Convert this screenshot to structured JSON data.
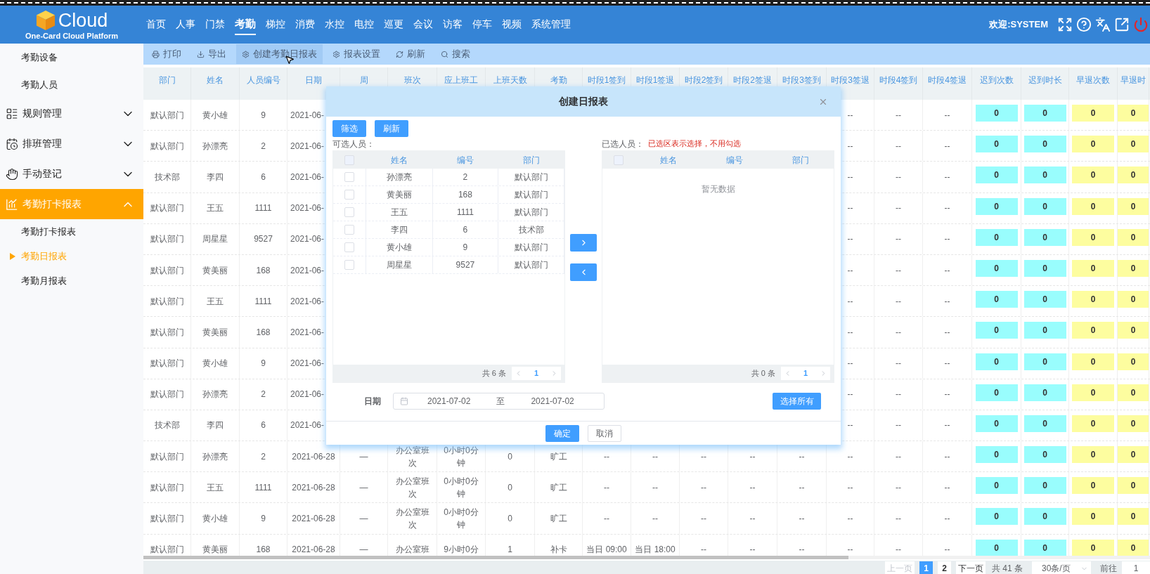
{
  "header": {
    "logo_text": "Cloud",
    "logo_subtitle": "One-Card Cloud Platform",
    "nav": [
      {
        "label": "首页",
        "selected": false
      },
      {
        "label": "人事",
        "selected": false
      },
      {
        "label": "门禁",
        "selected": false
      },
      {
        "label": "考勤",
        "selected": true
      },
      {
        "label": "梯控",
        "selected": false
      },
      {
        "label": "消费",
        "selected": false
      },
      {
        "label": "水控",
        "selected": false
      },
      {
        "label": "电控",
        "selected": false
      },
      {
        "label": "巡更",
        "selected": false
      },
      {
        "label": "会议",
        "selected": false
      },
      {
        "label": "访客",
        "selected": false
      },
      {
        "label": "停车",
        "selected": false
      },
      {
        "label": "视频",
        "selected": false
      },
      {
        "label": "系统管理",
        "selected": false
      }
    ],
    "welcome": "欢迎:SYSTEM"
  },
  "sidebar": {
    "items": [
      {
        "kind": "link",
        "label": "考勤设备",
        "selected": false
      },
      {
        "kind": "link",
        "label": "考勤人员",
        "selected": false
      },
      {
        "kind": "group",
        "label": "规则管理",
        "selected": false,
        "expanded": false
      },
      {
        "kind": "group",
        "label": "排班管理",
        "selected": false,
        "expanded": false
      },
      {
        "kind": "group",
        "label": "手动登记",
        "selected": false,
        "expanded": false
      },
      {
        "kind": "group",
        "label": "考勤打卡报表",
        "selected": true,
        "expanded": true,
        "children": [
          {
            "label": "考勤打卡报表",
            "selected": false
          },
          {
            "label": "考勤日报表",
            "selected": true
          },
          {
            "label": "考勤月报表",
            "selected": false
          }
        ]
      }
    ]
  },
  "toolbar": {
    "buttons": [
      {
        "label": "打印",
        "highlighted": false
      },
      {
        "label": "导出",
        "highlighted": false
      },
      {
        "label": "创建考勤日报表",
        "highlighted": true
      },
      {
        "label": "报表设置",
        "highlighted": false
      },
      {
        "label": "刷新",
        "highlighted": false
      },
      {
        "label": "搜索",
        "highlighted": false
      }
    ]
  },
  "table": {
    "columns": [
      {
        "label": "部门"
      },
      {
        "label": "姓名"
      },
      {
        "label": "人员编号"
      },
      {
        "label": "日期"
      },
      {
        "label": "周"
      },
      {
        "label": "班次"
      },
      {
        "label": "应上班工"
      },
      {
        "label": "上班天数"
      },
      {
        "label": "考勤"
      },
      {
        "label": "时段1签到"
      },
      {
        "label": "时段1签退"
      },
      {
        "label": "时段2签到"
      },
      {
        "label": "时段2签退"
      },
      {
        "label": "时段3签到"
      },
      {
        "label": "时段3签退"
      },
      {
        "label": "时段4签到"
      },
      {
        "label": "时段4签退"
      },
      {
        "label": "迟到次数",
        "color": "#99fdfd"
      },
      {
        "label": "迟到时长",
        "color": "#99fdfd"
      },
      {
        "label": "早退次数",
        "color": "#fdfd9f"
      },
      {
        "label": "早退时",
        "color": "#fdfd9f"
      }
    ],
    "rows": [
      {
        "cells": [
          "默认部门",
          "黄小雄",
          "9",
          "2021-06-",
          null,
          null,
          null,
          null,
          null,
          null,
          null,
          null,
          null,
          null,
          "--",
          "--",
          "--",
          "0",
          "0",
          "0",
          "0"
        ]
      },
      {
        "cells": [
          "默认部门",
          "孙漂亮",
          "2",
          "2021-06-",
          null,
          null,
          null,
          null,
          null,
          null,
          null,
          null,
          null,
          null,
          "--",
          "--",
          "--",
          "0",
          "0",
          "0",
          "0"
        ]
      },
      {
        "cells": [
          "技术部",
          "李四",
          "6",
          "2021-06-",
          null,
          null,
          null,
          null,
          null,
          null,
          null,
          null,
          null,
          null,
          "--",
          "--",
          "--",
          "0",
          "0",
          "0",
          "0"
        ]
      },
      {
        "cells": [
          "默认部门",
          "王五",
          "1111",
          "2021-06-",
          null,
          null,
          null,
          null,
          null,
          null,
          null,
          null,
          null,
          null,
          "--",
          "--",
          "--",
          "0",
          "0",
          "0",
          "0"
        ]
      },
      {
        "cells": [
          "默认部门",
          "周星星",
          "9527",
          "2021-06-",
          null,
          null,
          null,
          null,
          null,
          null,
          null,
          null,
          null,
          null,
          "--",
          "--",
          "--",
          "0",
          "0",
          "0",
          "0"
        ]
      },
      {
        "cells": [
          "默认部门",
          "黄美丽",
          "168",
          "2021-06-",
          null,
          null,
          null,
          null,
          null,
          null,
          null,
          null,
          null,
          null,
          "--",
          "--",
          "--",
          "0",
          "0",
          "0",
          "0"
        ]
      },
      {
        "cells": [
          "默认部门",
          "王五",
          "1111",
          "2021-06-",
          null,
          null,
          null,
          null,
          null,
          null,
          null,
          null,
          null,
          null,
          "--",
          "--",
          "--",
          "0",
          "0",
          "0",
          "0"
        ]
      },
      {
        "cells": [
          "默认部门",
          "黄美丽",
          "168",
          "2021-06-",
          null,
          null,
          null,
          null,
          null,
          null,
          null,
          null,
          null,
          null,
          "--",
          "--",
          "--",
          "0",
          "0",
          "0",
          "0"
        ]
      },
      {
        "cells": [
          "默认部门",
          "黄小雄",
          "9",
          "2021-06-",
          null,
          null,
          null,
          null,
          null,
          null,
          null,
          null,
          null,
          null,
          "--",
          "--",
          "--",
          "0",
          "0",
          "0",
          "0"
        ]
      },
      {
        "cells": [
          "默认部门",
          "孙漂亮",
          "2",
          "2021-06-",
          null,
          null,
          null,
          null,
          null,
          null,
          null,
          null,
          null,
          null,
          "--",
          "--",
          "--",
          "0",
          "0",
          "0",
          "0"
        ]
      },
      {
        "cells": [
          "技术部",
          "李四",
          "6",
          "2021-06-",
          null,
          null,
          null,
          null,
          null,
          null,
          null,
          null,
          null,
          null,
          "--",
          "--",
          "--",
          "0",
          "0",
          "0",
          "0"
        ]
      },
      {
        "cells": [
          "默认部门",
          "孙漂亮",
          "2",
          "2021-06-28",
          "—",
          "办公室班次",
          "0小时0分钟",
          "0",
          "旷工",
          "--",
          "--",
          "--",
          "--",
          "--",
          "--",
          "--",
          "--",
          "0",
          "0",
          "0",
          "0"
        ]
      },
      {
        "cells": [
          "默认部门",
          "王五",
          "1111",
          "2021-06-28",
          "—",
          "办公室班次",
          "0小时0分钟",
          "0",
          "旷工",
          "--",
          "--",
          "--",
          "--",
          "--",
          "--",
          "--",
          "--",
          "0",
          "0",
          "0",
          "0"
        ]
      },
      {
        "cells": [
          "默认部门",
          "黄小雄",
          "9",
          "2021-06-28",
          "—",
          "办公室班次",
          "0小时0分钟",
          "0",
          "旷工",
          "--",
          "--",
          "--",
          "--",
          "--",
          "--",
          "--",
          "--",
          "0",
          "0",
          "0",
          "0"
        ]
      },
      {
        "cells": [
          "默认部门",
          "黄美丽",
          "168",
          "2021-06-28",
          "—",
          "办公室班",
          "9小时0分",
          "1",
          "补卡",
          "当日 09:00",
          "当日 18:00",
          "--",
          "--",
          "--",
          "--",
          "--",
          "--",
          "0",
          "0",
          "0",
          "0"
        ]
      }
    ]
  },
  "pagination": {
    "prev": {
      "label": "上一页",
      "disabled": true
    },
    "pages": [
      {
        "label": "1",
        "selected": true
      },
      {
        "label": "2",
        "selected": false
      }
    ],
    "next": {
      "label": "下一页",
      "disabled": false
    },
    "total": "共 41 条",
    "page_size": "30条/页",
    "goto_label": "前往",
    "goto_value": "1"
  },
  "dialog": {
    "title": "创建日报表",
    "top_buttons": [
      "筛选",
      "刷新"
    ],
    "available": {
      "label": "可选人员：",
      "all_checked": false,
      "columns": [
        "姓名",
        "编号",
        "部门"
      ],
      "rows": [
        {
          "name": "孙漂亮",
          "id": "2",
          "dept": "默认部门",
          "checked": false
        },
        {
          "name": "黄美丽",
          "id": "168",
          "dept": "默认部门",
          "checked": false
        },
        {
          "name": "王五",
          "id": "1111",
          "dept": "默认部门",
          "checked": false
        },
        {
          "name": "李四",
          "id": "6",
          "dept": "技术部",
          "checked": false
        },
        {
          "name": "黄小雄",
          "id": "9",
          "dept": "默认部门",
          "checked": false
        },
        {
          "name": "周星星",
          "id": "9527",
          "dept": "默认部门",
          "checked": false
        }
      ],
      "total": "共 6 条",
      "page": "1"
    },
    "chosen": {
      "label": "已选人员：",
      "hint": "已选区表示选择，不用勾选",
      "all_checked": false,
      "columns": [
        "姓名",
        "编号",
        "部门"
      ],
      "empty_text": "暂无数据",
      "total": "共 0 条",
      "page": "1"
    },
    "date": {
      "label": "日期",
      "start": "2021-07-02",
      "separator": "至",
      "end": "2021-07-02"
    },
    "select_all": "选择所有",
    "footer_buttons": [
      {
        "label": "确定",
        "primary": true
      },
      {
        "label": "取消",
        "primary": false
      }
    ]
  }
}
